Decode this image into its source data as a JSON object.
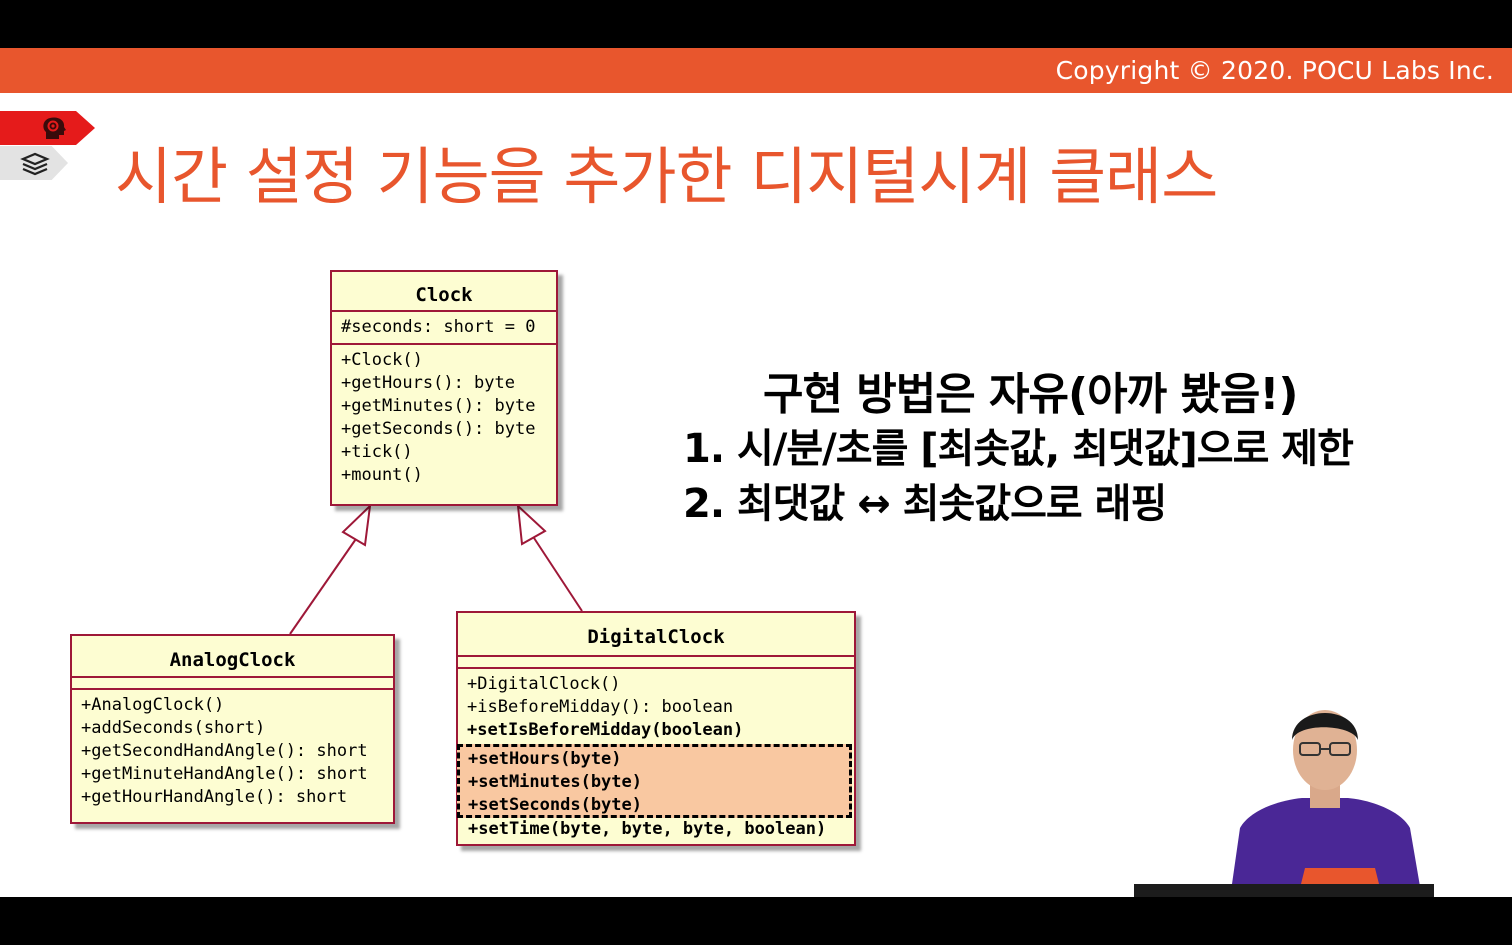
{
  "header": {
    "copyright": "Copyright © 2020. POCU Labs Inc.",
    "accent_color": "#e8562d"
  },
  "nav_icons": {
    "top": "head-gear-icon",
    "bottom": "books-icon"
  },
  "slide": {
    "title": "시간 설정 기능을 추가한 디지털시계 클래스"
  },
  "uml": {
    "clock": {
      "name": "Clock",
      "attributes": [
        "#seconds: short = 0"
      ],
      "methods": [
        "+Clock()",
        "+getHours(): byte",
        "+getMinutes(): byte",
        "+getSeconds(): byte",
        "+tick()",
        "+mount()"
      ]
    },
    "analog_clock": {
      "name": "AnalogClock",
      "methods": [
        "+AnalogClock()",
        "+addSeconds(short)",
        "+getSecondHandAngle(): short",
        "+getMinuteHandAngle(): short",
        "+getHourHandAngle(): short"
      ]
    },
    "digital_clock": {
      "name": "DigitalClock",
      "methods": [
        "+DigitalClock()",
        "+isBeforeMidday(): boolean",
        "+setIsBeforeMidday(boolean)"
      ],
      "highlighted_methods": [
        "+setHours(byte)",
        "+setMinutes(byte)",
        "+setSeconds(byte)"
      ],
      "last_method": "+setTime(byte, byte, byte, boolean)"
    },
    "border_color": "#9e1838",
    "fill_color": "#fdfdd2",
    "highlight_color": "#f9c8a1"
  },
  "notes": {
    "heading": "구현 방법은 자유(아까 봤음!)",
    "items": [
      "1.  시/분/초를 [최솟값, 최댓값]으로 제한",
      "2.  최댓값 ↔ 최솟값으로 래핑"
    ]
  }
}
